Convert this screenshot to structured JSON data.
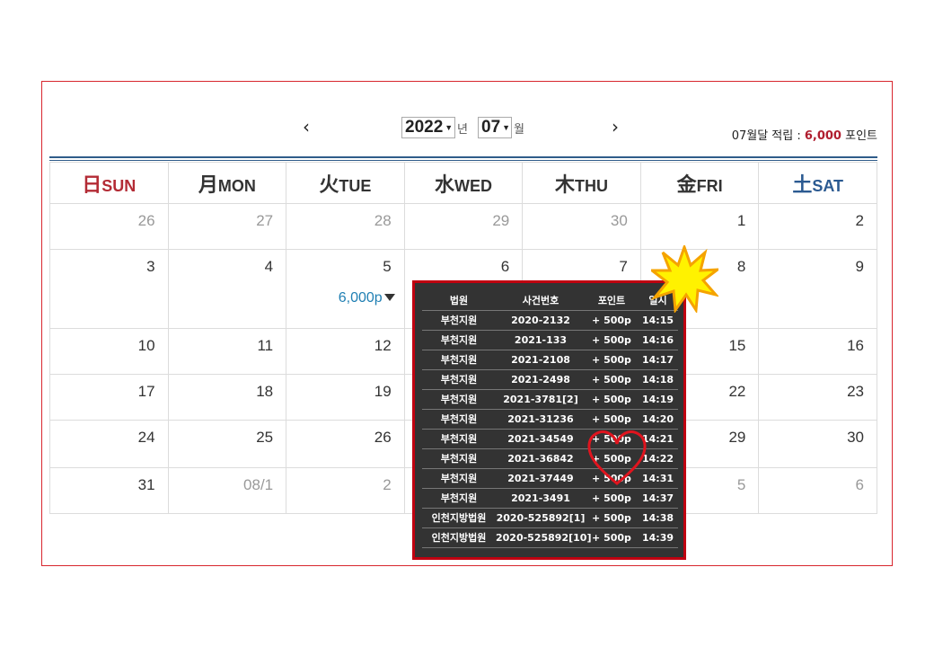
{
  "header": {
    "prev_icon": "chevron-left-icon",
    "next_icon": "chevron-right-icon",
    "year_value": "2022",
    "year_unit": "년",
    "month_value": "07",
    "month_unit": "월",
    "summary_prefix": "07월달 적립 : ",
    "summary_points": "6,000",
    "summary_suffix": " 포인트"
  },
  "colors": {
    "accent_red": "#b01e2f",
    "sunday": "#b32b35",
    "saturday": "#2b5a91",
    "earn_blue": "#1f7fb3",
    "popup_border": "#c00010",
    "popup_bg": "#333333"
  },
  "weekdays": [
    {
      "han": "日",
      "en": "SUN"
    },
    {
      "han": "月",
      "en": "MON"
    },
    {
      "han": "火",
      "en": "TUE"
    },
    {
      "han": "水",
      "en": "WED"
    },
    {
      "han": "木",
      "en": "THU"
    },
    {
      "han": "金",
      "en": "FRI"
    },
    {
      "han": "土",
      "en": "SAT"
    }
  ],
  "weeks": [
    [
      "26",
      "27",
      "28",
      "29",
      "30",
      "1",
      "2"
    ],
    [
      "3",
      "4",
      "5",
      "6",
      "7",
      "8",
      "9"
    ],
    [
      "10",
      "11",
      "12",
      "",
      "",
      "15",
      "16"
    ],
    [
      "17",
      "18",
      "19",
      "",
      "",
      "22",
      "23"
    ],
    [
      "24",
      "25",
      "26",
      "",
      "",
      "29",
      "30"
    ],
    [
      "31",
      "08/1",
      "2",
      "",
      "",
      "5",
      "6"
    ]
  ],
  "earning": {
    "day": "5",
    "label": "6,000p"
  },
  "popup": {
    "headers": [
      "법원",
      "사건번호",
      "포인트",
      "일시"
    ],
    "rows": [
      [
        "부천지원",
        "2020-2132",
        "+ 500p",
        "14:15"
      ],
      [
        "부천지원",
        "2021-133",
        "+ 500p",
        "14:16"
      ],
      [
        "부천지원",
        "2021-2108",
        "+ 500p",
        "14:17"
      ],
      [
        "부천지원",
        "2021-2498",
        "+ 500p",
        "14:18"
      ],
      [
        "부천지원",
        "2021-3781[2]",
        "+ 500p",
        "14:19"
      ],
      [
        "부천지원",
        "2021-31236",
        "+ 500p",
        "14:20"
      ],
      [
        "부천지원",
        "2021-34549",
        "+ 500p",
        "14:21"
      ],
      [
        "부천지원",
        "2021-36842",
        "+ 500p",
        "14:22"
      ],
      [
        "부천지원",
        "2021-37449",
        "+ 500p",
        "14:31"
      ],
      [
        "부천지원",
        "2021-3491",
        "+ 500p",
        "14:37"
      ],
      [
        "인천지방법원",
        "2020-525892[1]",
        "+ 500p",
        "14:38"
      ],
      [
        "인천지방법원",
        "2020-525892[10]",
        "+ 500p",
        "14:39"
      ]
    ]
  },
  "annotations": {
    "burst": "burst-icon",
    "heart": "heart-icon"
  }
}
